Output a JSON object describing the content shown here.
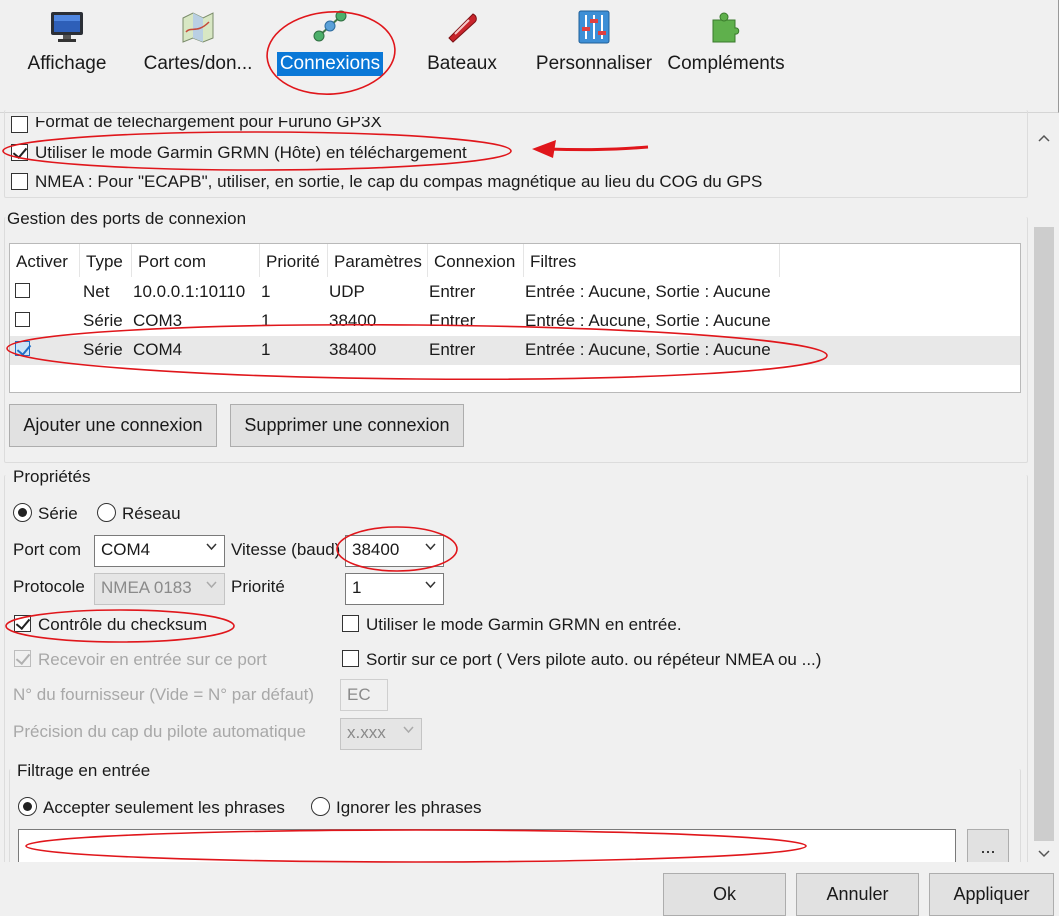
{
  "toolbar": {
    "items": [
      {
        "label": "Affichage",
        "icon": "monitor-icon"
      },
      {
        "label": "Cartes/don...",
        "icon": "charts-icon"
      },
      {
        "label": "Connexions",
        "icon": "connections-icon"
      },
      {
        "label": "Bateaux",
        "icon": "boat-icon"
      },
      {
        "label": "Personnaliser",
        "icon": "sliders-icon"
      },
      {
        "label": "Compléments",
        "icon": "puzzle-icon"
      }
    ]
  },
  "general_options": {
    "furuno": "Format de téléchargement pour Furuno GP3X",
    "garmin_host": "Utiliser le mode Garmin GRMN (Hôte) en téléchargement",
    "nmea_ecapb": "NMEA : Pour \"ECAPB\", utiliser, en sortie, le cap du compas magnétique  au lieu du COG du GPS"
  },
  "ports": {
    "title": "Gestion des ports de connexion",
    "columns": [
      "Activer",
      "Type",
      "Port com",
      "Priorité",
      "Paramètres",
      "Connexion",
      "Filtres"
    ],
    "rows": [
      {
        "active": false,
        "type": "Net",
        "port": "10.0.0.1:10110",
        "priority": "1",
        "params": "UDP",
        "connection": "Entrer",
        "filters": "Entrée : Aucune, Sortie : Aucune"
      },
      {
        "active": false,
        "type": "Série",
        "port": "COM3",
        "priority": "1",
        "params": "38400",
        "connection": "Entrer",
        "filters": "Entrée : Aucune, Sortie : Aucune"
      },
      {
        "active": true,
        "type": "Série",
        "port": "COM4",
        "priority": "1",
        "params": "38400",
        "connection": "Entrer",
        "filters": "Entrée : Aucune, Sortie : Aucune"
      }
    ],
    "add_button": "Ajouter une connexion",
    "remove_button": "Supprimer une connexion"
  },
  "properties": {
    "title": "Propriétés",
    "serial_label": "Série",
    "network_label": "Réseau",
    "port_com_label": "Port com",
    "port_com_value": "COM4",
    "baud_label": "Vitesse (baud)",
    "baud_value": "38400",
    "protocol_label": "Protocole",
    "protocol_value": "NMEA 0183",
    "priority_label": "Priorité",
    "priority_value": "1",
    "checksum_label": "Contrôle du checksum",
    "garmin_input_label": "Utiliser le mode Garmin GRMN en entrée.",
    "receive_label": "Recevoir en entrée sur ce port",
    "output_label": "Sortir sur ce port ( Vers pilote auto. ou répéteur NMEA ou ...)",
    "talker_label": "N° du fournisseur (Vide = N° par défaut)",
    "talker_value": "EC",
    "precision_label": "Précision du cap du pilote automatique",
    "precision_value": "x.xxx"
  },
  "input_filter": {
    "title": "Filtrage en entrée",
    "accept_label": "Accepter seulement les phrases",
    "ignore_label": "Ignorer les phrases",
    "sentences_value": "",
    "browse_button": "..."
  },
  "footer": {
    "ok": "Ok",
    "cancel": "Annuler",
    "apply": "Appliquer"
  },
  "colors": {
    "accent": "#0a78d7",
    "annotation": "#e0161b"
  }
}
